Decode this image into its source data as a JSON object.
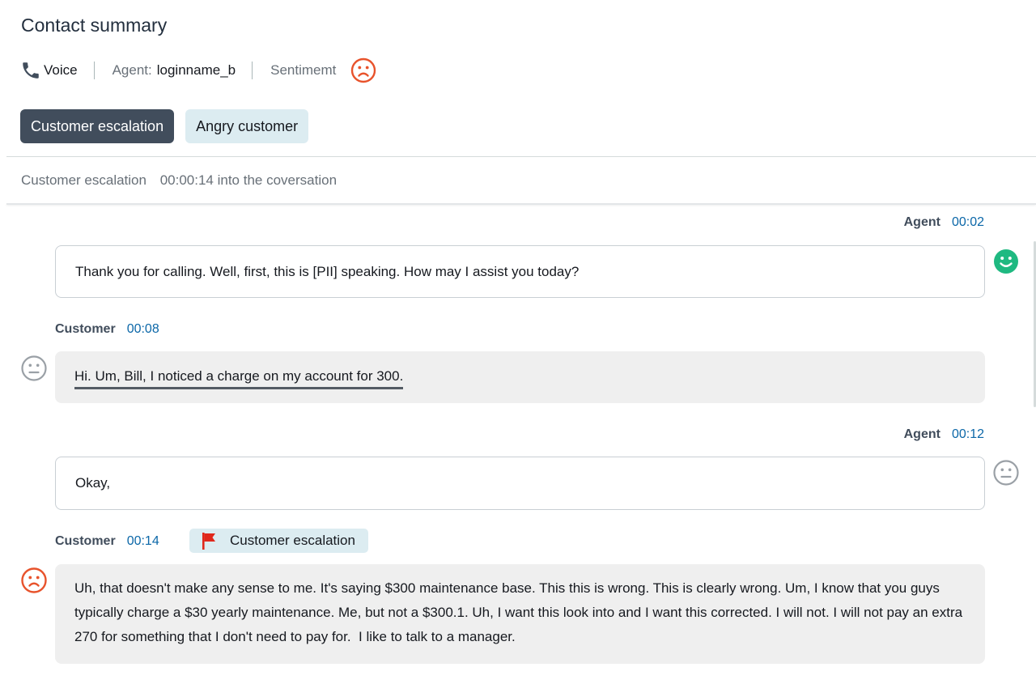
{
  "header": {
    "title": "Contact summary",
    "channel": "Voice",
    "agent_label": "Agent:",
    "agent_name": "loginname_b",
    "sentiment_label": "Sentimemt"
  },
  "tags": [
    "Customer escalation",
    "Angry customer"
  ],
  "section": {
    "name": "Customer escalation",
    "time": "00:00:14 into the coversation"
  },
  "transcript": [
    {
      "speaker": "Agent",
      "time": "00:02",
      "text": "Thank you for calling. Well, first, this is [PII] speaking. How may I assist you today?",
      "sentiment": "positive"
    },
    {
      "speaker": "Customer",
      "time": "00:08",
      "text": "Hi. Um, Bill, I noticed a charge on my account for 300.",
      "sentiment": "neutral"
    },
    {
      "speaker": "Agent",
      "time": "00:12",
      "text": "Okay,",
      "sentiment": "neutral"
    },
    {
      "speaker": "Customer",
      "time": "00:14",
      "category": "Customer escalation",
      "text": "Uh, that doesn't make any sense to me. It's saying $300 maintenance base. This this is wrong. This is clearly wrong. Um, I know that you guys typically charge a $30 yearly maintenance. Me, but not a $300.1. Uh, I want this look into and I want this corrected. I will not. I will not pay an extra 270 for something that I don't need to pay for.  I like to talk to a manager.",
      "sentiment": "negative"
    }
  ],
  "colors": {
    "positive": "#1fb981",
    "negative": "#e8532c",
    "neutral": "#9aa0a6",
    "timestamp": "#0b67a8",
    "flag": "#e0281c"
  },
  "icons": {
    "channel": "phone-icon",
    "sentiment": "sad-face-icon",
    "flag": "flag-icon"
  }
}
